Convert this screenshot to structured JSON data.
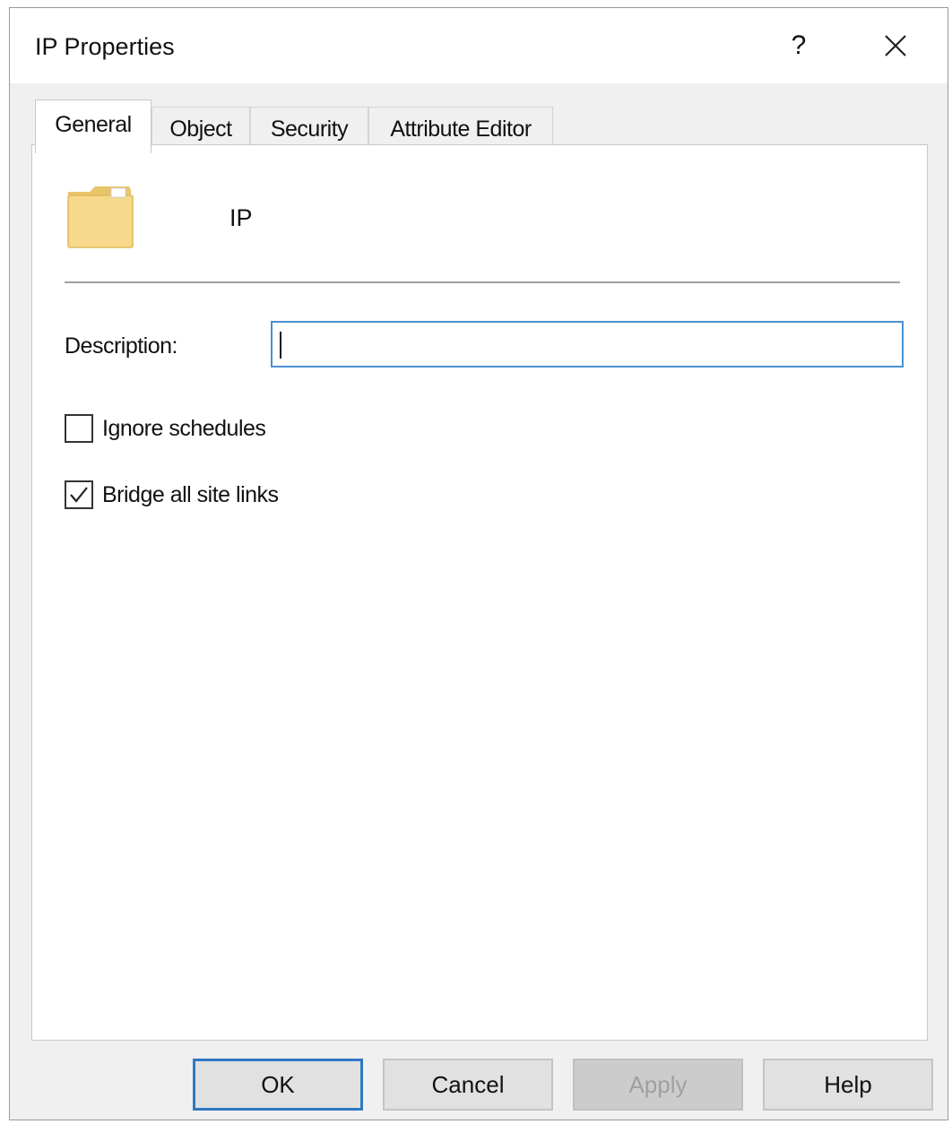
{
  "window": {
    "title": "IP Properties",
    "help_symbol": "?",
    "close_icon": "close-icon"
  },
  "tabs": [
    {
      "label": "General",
      "active": true
    },
    {
      "label": "Object",
      "active": false
    },
    {
      "label": "Security",
      "active": false
    },
    {
      "label": "Attribute Editor",
      "active": false
    }
  ],
  "general": {
    "object_icon": "folder-icon",
    "object_name": "IP",
    "description_label": "Description:",
    "description_value": "",
    "ignore_schedules": {
      "label": "Ignore schedules",
      "checked": false
    },
    "bridge_all_site_links": {
      "label": "Bridge all site links",
      "checked": true
    }
  },
  "buttons": {
    "ok": "OK",
    "cancel": "Cancel",
    "apply": "Apply",
    "help": "Help"
  },
  "colors": {
    "focus_border": "#2f78c4",
    "folder_fill": "#f5d888"
  }
}
